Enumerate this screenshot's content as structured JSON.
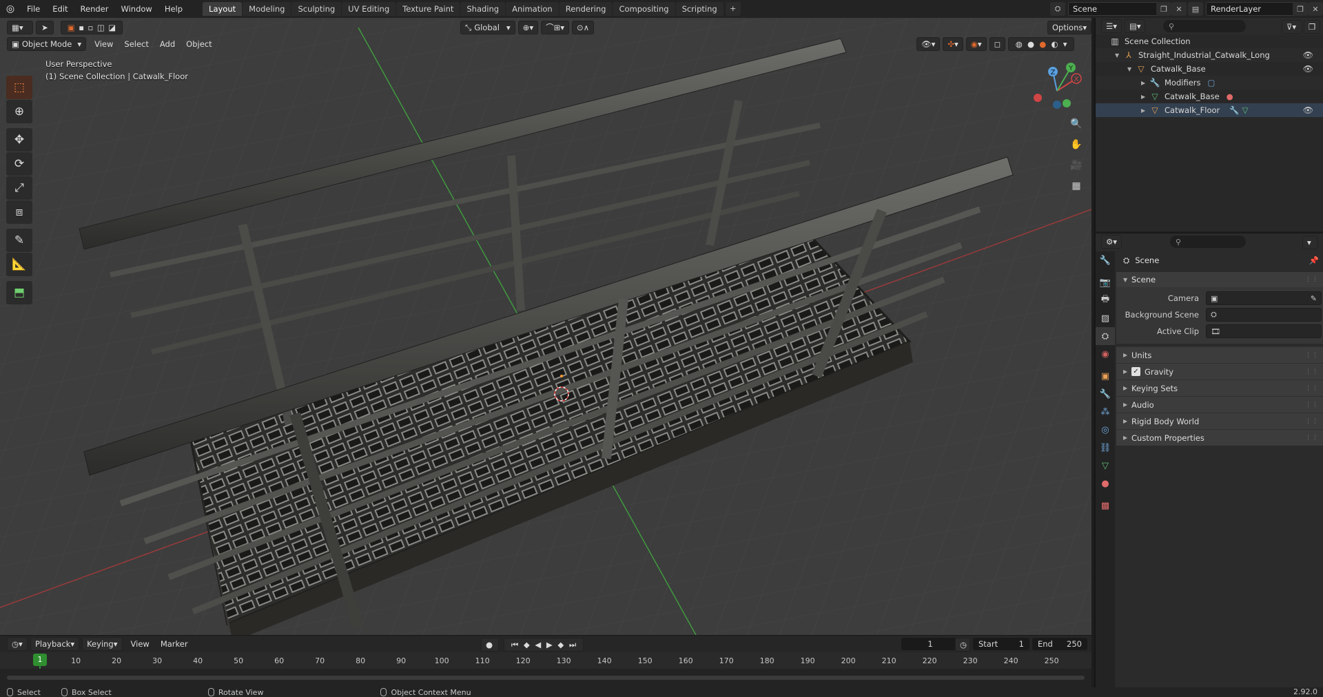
{
  "app": {
    "menu": [
      "File",
      "Edit",
      "Render",
      "Window",
      "Help"
    ],
    "workspaces": [
      "Layout",
      "Modeling",
      "Sculpting",
      "UV Editing",
      "Texture Paint",
      "Shading",
      "Animation",
      "Rendering",
      "Compositing",
      "Scripting"
    ],
    "active_workspace": "Layout",
    "add_tab": "+",
    "scene_name": "Scene",
    "view_layer": "RenderLayer",
    "version": "2.92.0"
  },
  "viewport": {
    "mode": "Object Mode",
    "menus": [
      "View",
      "Select",
      "Add",
      "Object"
    ],
    "orientation": "Global",
    "options_label": "Options",
    "perspective_label": "User Perspective",
    "collection_label": "(1) Scene Collection | Catwalk_Floor",
    "gizmo": {
      "x": "X",
      "y": "Y",
      "z": "Z"
    }
  },
  "timeline": {
    "menus": [
      "Playback",
      "Keying",
      "View",
      "Marker"
    ],
    "current_frame": "1",
    "start_label": "Start",
    "start_value": "1",
    "end_label": "End",
    "end_value": "250",
    "ticks": [
      "10",
      "20",
      "30",
      "40",
      "50",
      "60",
      "70",
      "80",
      "90",
      "100",
      "110",
      "120",
      "130",
      "140",
      "150",
      "160",
      "170",
      "180",
      "190",
      "200",
      "210",
      "220",
      "230",
      "240",
      "250"
    ],
    "playhead_label": "1"
  },
  "statusbar": {
    "items": [
      "Select",
      "Box Select",
      "Rotate View",
      "Object Context Menu"
    ],
    "version": "2.92.0"
  },
  "outliner": {
    "rows": [
      {
        "label": "Scene Collection",
        "icon": "collection-icon"
      },
      {
        "label": "Straight_Industrial_Catwalk_Long",
        "icon": "empty-icon"
      },
      {
        "label": "Catwalk_Base",
        "icon": "mesh-object-icon"
      },
      {
        "label": "Modifiers",
        "icon": "wrench-icon"
      },
      {
        "label": "Catwalk_Base",
        "icon": "mesh-data-icon"
      },
      {
        "label": "Catwalk_Floor",
        "icon": "mesh-object-icon"
      }
    ]
  },
  "properties": {
    "context_title": "Scene",
    "panel": "Scene",
    "fields": [
      {
        "label": "Camera",
        "value": ""
      },
      {
        "label": "Background Scene",
        "value": ""
      },
      {
        "label": "Active Clip",
        "value": ""
      }
    ],
    "subpanels": [
      "Units",
      "Gravity",
      "Keying Sets",
      "Audio",
      "Rigid Body World",
      "Custom Properties"
    ]
  }
}
